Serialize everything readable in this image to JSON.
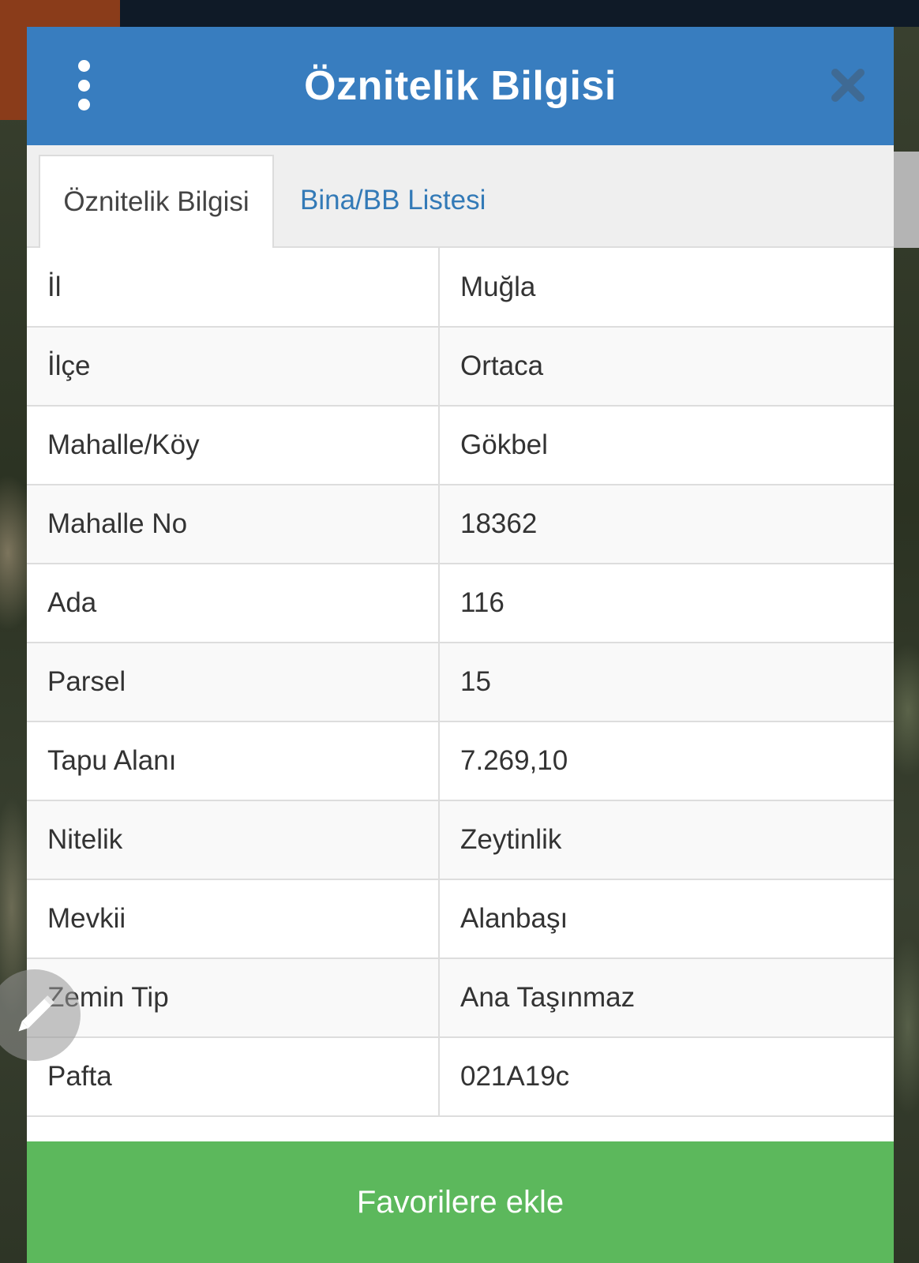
{
  "dialog": {
    "title": "Öznitelik Bilgisi"
  },
  "tabs": [
    {
      "label": "Öznitelik Bilgisi",
      "active": true
    },
    {
      "label": "Bina/BB Listesi",
      "active": false
    }
  ],
  "attributes": [
    {
      "key": "İl",
      "value": "Muğla"
    },
    {
      "key": "İlçe",
      "value": "Ortaca"
    },
    {
      "key": "Mahalle/Köy",
      "value": "Gökbel"
    },
    {
      "key": "Mahalle No",
      "value": "18362"
    },
    {
      "key": "Ada",
      "value": "116"
    },
    {
      "key": "Parsel",
      "value": "15"
    },
    {
      "key": "Tapu Alanı",
      "value": "7.269,10"
    },
    {
      "key": "Nitelik",
      "value": "Zeytinlik"
    },
    {
      "key": "Mevkii",
      "value": "Alanbaşı"
    },
    {
      "key": "Zemin Tip",
      "value": "Ana Taşınmaz"
    },
    {
      "key": "Pafta",
      "value": "021A19c"
    }
  ],
  "favorite_button": {
    "label": "Favorilere ekle"
  },
  "icons": {
    "menu": "vertical-dots-icon",
    "close": "close-icon",
    "edit": "pencil-icon"
  },
  "colors": {
    "header": "#387dbf",
    "tab_link": "#337ab7",
    "favorite_button": "#5cb85c"
  }
}
